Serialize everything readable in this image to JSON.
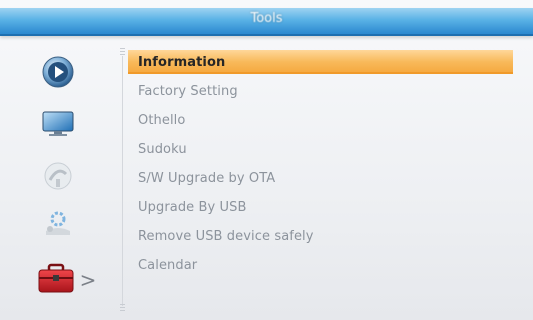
{
  "title": "Tools",
  "sidebar": {
    "items": [
      {
        "icon": "play-icon"
      },
      {
        "icon": "tv-icon"
      },
      {
        "icon": "satellite-icon"
      },
      {
        "icon": "settings-icon"
      },
      {
        "icon": "toolbox-icon"
      }
    ],
    "active_indicator": ">"
  },
  "menu": {
    "selected_index": 0,
    "items": [
      {
        "label": "Information"
      },
      {
        "label": "Factory Setting"
      },
      {
        "label": "Othello"
      },
      {
        "label": "Sudoku"
      },
      {
        "label": "S/W Upgrade by OTA"
      },
      {
        "label": "Upgrade By USB"
      },
      {
        "label": "Remove USB device safely"
      },
      {
        "label": "Calendar"
      }
    ]
  },
  "colors": {
    "header_blue": "#2b88cf",
    "highlight_orange": "#f5a73c",
    "text_gray": "#8c939c"
  }
}
